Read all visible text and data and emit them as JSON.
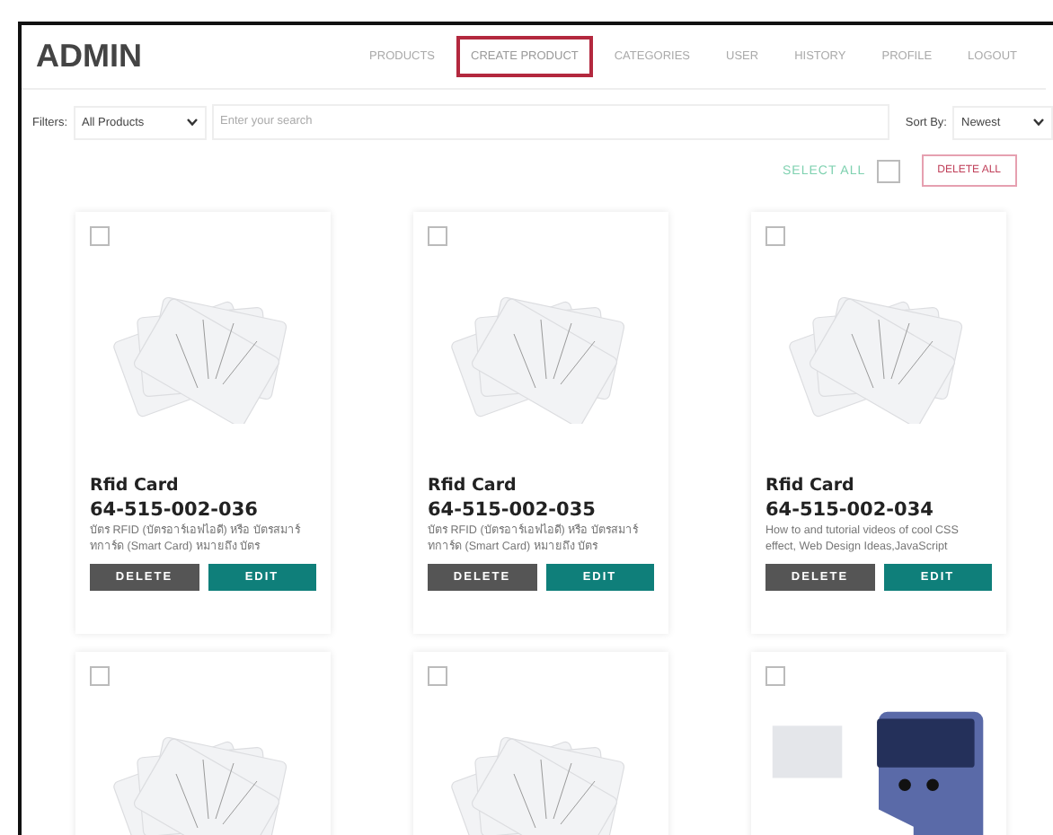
{
  "header": {
    "title": "ADMIN",
    "nav": [
      {
        "label": "PRODUCTS",
        "selected": false
      },
      {
        "label": "CREATE PRODUCT",
        "selected": true
      },
      {
        "label": "CATEGORIES",
        "selected": false
      },
      {
        "label": "USER",
        "selected": false
      },
      {
        "label": "HISTORY",
        "selected": false
      },
      {
        "label": "PROFILE",
        "selected": false
      },
      {
        "label": "LOGOUT",
        "selected": false
      }
    ]
  },
  "filters": {
    "label": "Filters:",
    "category": "All Products",
    "placeholder": "Enter your search",
    "sort_label": "Sort By:",
    "sort": "Newest"
  },
  "bulk": {
    "select_all": "SELECT ALL",
    "checked": false,
    "delete_all": "DELETE ALL"
  },
  "products": [
    {
      "kind": "cards",
      "checked": false,
      "name": "Rfid Card",
      "code": "64-515-002-036",
      "description": "บัตร RFID (บัตรอาร์เอฟไอดี) หรือ บัตรสมาร์ทการ์ด (Smart Card) หมายถึง บัตร",
      "delete": "DELETE",
      "edit": "EDIT"
    },
    {
      "kind": "cards",
      "checked": false,
      "name": "Rfid Card",
      "code": "64-515-002-035",
      "description": "บัตร RFID (บัตรอาร์เอฟไอดี) หรือ บัตรสมาร์ทการ์ด (Smart Card) หมายถึง บัตร",
      "delete": "DELETE",
      "edit": "EDIT"
    },
    {
      "kind": "cards",
      "checked": false,
      "name": "Rfid Card",
      "code": "64-515-002-034",
      "description": "How to and tutorial videos of cool CSS effect, Web Design Ideas,JavaScript",
      "delete": "DELETE",
      "edit": "EDIT"
    },
    {
      "kind": "cards",
      "checked": false
    },
    {
      "kind": "cards",
      "checked": false
    },
    {
      "kind": "writer",
      "checked": false
    }
  ]
}
